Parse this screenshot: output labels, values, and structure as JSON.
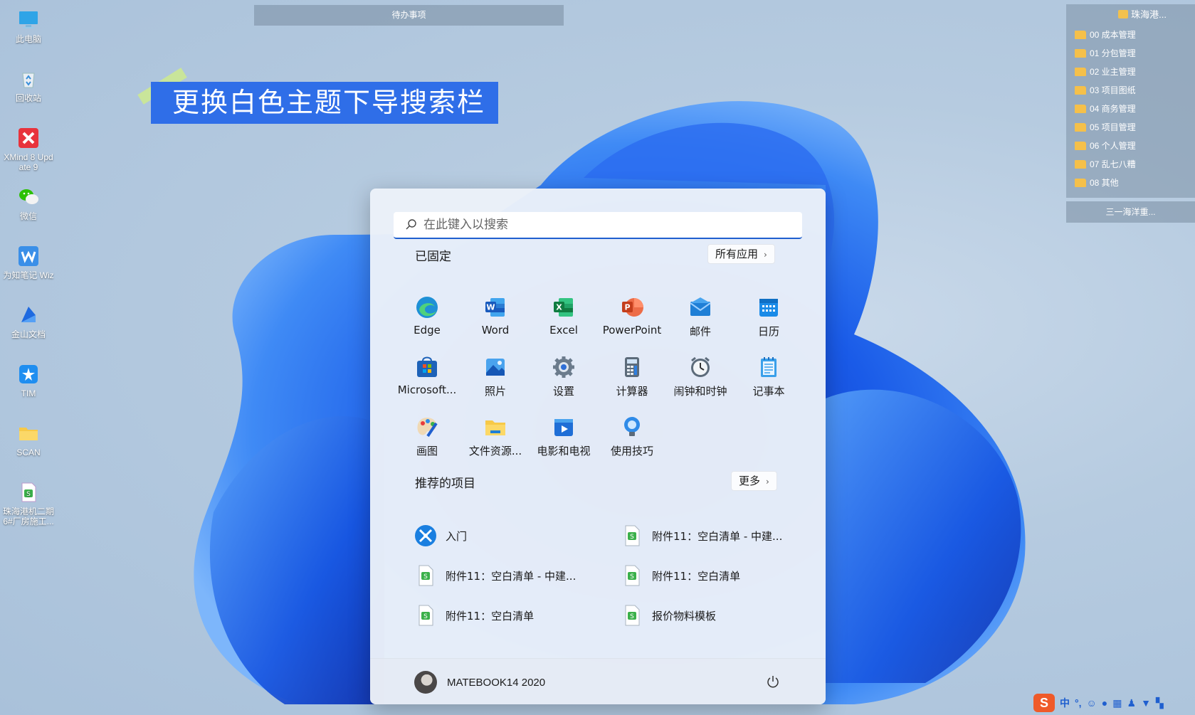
{
  "desktop": {
    "icons": [
      {
        "label": "此电脑",
        "icon": "computer-icon"
      },
      {
        "label": "回收站",
        "icon": "recycle-bin-icon"
      },
      {
        "label": "XMind 8 Update 9",
        "icon": "xmind-icon"
      },
      {
        "label": "微信",
        "icon": "wechat-icon"
      },
      {
        "label": "为知笔记 Wiz",
        "icon": "wiznote-icon"
      },
      {
        "label": "金山文档",
        "icon": "kdocs-icon"
      },
      {
        "label": "TIM",
        "icon": "tim-icon"
      },
      {
        "label": "SCAN",
        "icon": "folder-icon"
      },
      {
        "label": "珠海港机二期6#厂房施工...",
        "icon": "spreadsheet-icon"
      }
    ],
    "todo_title": "待办事项",
    "caption": "更换白色主题下导搜索栏",
    "folder_panel": {
      "title": "珠海港...",
      "items": [
        "00 成本管理",
        "01 分包管理",
        "02 业主管理",
        "03 项目图纸",
        "04 商务管理",
        "05 项目管理",
        "06 个人管理",
        "07 乱七八糟",
        "08 其他"
      ],
      "footer": "三一海洋重..."
    }
  },
  "start_menu": {
    "search_placeholder": "在此键入以搜索",
    "pinned_title": "已固定",
    "all_apps_label": "所有应用",
    "pinned_apps": [
      {
        "label": "Edge",
        "icon": "edge-icon"
      },
      {
        "label": "Word",
        "icon": "word-icon"
      },
      {
        "label": "Excel",
        "icon": "excel-icon"
      },
      {
        "label": "PowerPoint",
        "icon": "powerpoint-icon"
      },
      {
        "label": "邮件",
        "icon": "mail-icon"
      },
      {
        "label": "日历",
        "icon": "calendar-icon"
      },
      {
        "label": "Microsoft...",
        "icon": "store-icon"
      },
      {
        "label": "照片",
        "icon": "photos-icon"
      },
      {
        "label": "设置",
        "icon": "settings-icon"
      },
      {
        "label": "计算器",
        "icon": "calculator-icon"
      },
      {
        "label": "闹钟和时钟",
        "icon": "clock-icon"
      },
      {
        "label": "记事本",
        "icon": "notepad-icon"
      },
      {
        "label": "画图",
        "icon": "paint-icon"
      },
      {
        "label": "文件资源...",
        "icon": "file-explorer-icon"
      },
      {
        "label": "电影和电视",
        "icon": "movies-icon"
      },
      {
        "label": "使用技巧",
        "icon": "tips-icon"
      }
    ],
    "recommended_title": "推荐的项目",
    "more_label": "更多",
    "recommended": [
      {
        "label": "入门",
        "icon": "get-started-icon"
      },
      {
        "label": "附件11：空白清单 - 中建...",
        "icon": "spreadsheet-icon"
      },
      {
        "label": "附件11：空白清单 - 中建...",
        "icon": "spreadsheet-icon"
      },
      {
        "label": "附件11：空白清单",
        "icon": "spreadsheet-icon"
      },
      {
        "label": "附件11：空白清单",
        "icon": "spreadsheet-icon"
      },
      {
        "label": "报价物料模板",
        "icon": "spreadsheet-icon"
      }
    ],
    "user_name": "MATEBOOK14 2020"
  },
  "tray": {
    "ime_lang": "中",
    "punct": "°,"
  }
}
